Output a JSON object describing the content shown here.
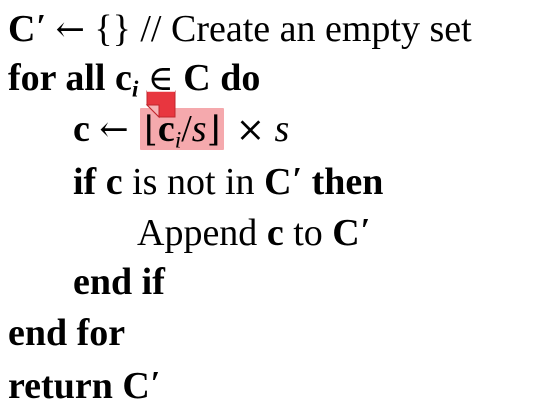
{
  "algorithm": {
    "line1": {
      "var": "C",
      "prime": "′",
      "arrow": "←",
      "set": "{}",
      "comment": "// Create an empty set"
    },
    "line2": {
      "kw_for_all": "for all",
      "var_c": "c",
      "sub_i": "i",
      "elem": "∈",
      "var_C": "C",
      "kw_do": "do"
    },
    "line3": {
      "var_c": "c",
      "arrow": "←",
      "lfloor": "⌊",
      "var_c2": "c",
      "sub_i": "i",
      "slash": "/",
      "var_s": "s",
      "rfloor": "⌋",
      "times": "×",
      "var_s2": "s"
    },
    "line4": {
      "kw_if": "if",
      "var_c": "c",
      "text": "is not in",
      "var_C": "C",
      "prime": "′",
      "kw_then": "then"
    },
    "line5": {
      "text1": "Append",
      "var_c": "c",
      "text2": "to",
      "var_C": "C",
      "prime": "′"
    },
    "line6": {
      "kw": "end if"
    },
    "line7": {
      "kw": "end for"
    },
    "line8": {
      "kw": "return",
      "var_C": "C",
      "prime": "′"
    }
  },
  "colors": {
    "highlight": "#f5a9ad",
    "annotation_icon": "#e8363f"
  },
  "icons": {
    "annotation": "sticky-note-icon"
  }
}
